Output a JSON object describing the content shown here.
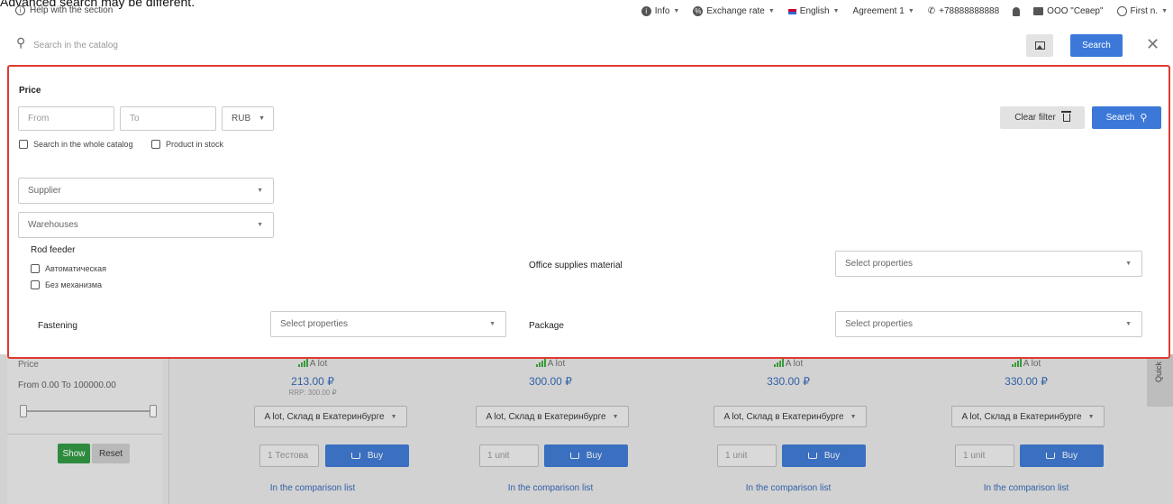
{
  "caption": "Advanced search may be different.",
  "topbar": {
    "help": "Help with the section",
    "info": "Info",
    "exchange": "Exchange rate",
    "language": "English",
    "agreement": "Agreement 1",
    "phone": "+78888888888",
    "company": "ООО \"Север\"",
    "user": "First n."
  },
  "search": {
    "placeholder": "Search in the catalog",
    "button": "Search"
  },
  "filter": {
    "price_heading": "Price",
    "from_placeholder": "From",
    "to_placeholder": "To",
    "currency": "RUB",
    "whole_catalog": "Search in the whole catalog",
    "in_stock": "Product in stock",
    "supplier": "Supplier",
    "warehouses": "Warehouses",
    "clear_filter": "Clear filter",
    "search": "Search",
    "rod_feeder": {
      "label": "Rod feeder",
      "options": [
        "Автоматическая",
        "Без механизма"
      ]
    },
    "office_supplies_label": "Office supplies material",
    "fastening_label": "Fastening",
    "package_label": "Package",
    "select_properties": "Select properties"
  },
  "sidebar_bg": {
    "price_label": "Price",
    "range": "From 0.00 To 100000.00",
    "show": "Show",
    "reset": "Reset"
  },
  "products": [
    {
      "availability": "A lot",
      "price": "213.00 ₽",
      "rrp": "RRP: 300.00 ₽",
      "warehouse": "A lot, Склад в Екатеринбурге",
      "qty": "1 Тестова",
      "buy": "Buy",
      "compare": "In the comparison list"
    },
    {
      "availability": "A lot",
      "price": "300.00 ₽",
      "rrp": "",
      "warehouse": "A lot, Склад в Екатеринбурге",
      "qty": "1 unit",
      "buy": "Buy",
      "compare": "In the comparison list"
    },
    {
      "availability": "A lot",
      "price": "330.00 ₽",
      "rrp": "",
      "warehouse": "A lot, Склад в Екатеринбурге",
      "qty": "1 unit",
      "buy": "Buy",
      "compare": "In the comparison list"
    },
    {
      "availability": "A lot",
      "price": "330.00 ₽",
      "rrp": "",
      "warehouse": "A lot, Склад в Екатеринбурге",
      "qty": "1 unit",
      "buy": "Buy",
      "compare": "In the comparison list"
    }
  ],
  "quick_tab": "Quick",
  "colors": {
    "accent": "#3b78d8",
    "highlight_border": "#e03a2f",
    "price": "#2f5fa6",
    "show_green": "#2e8b3e"
  }
}
